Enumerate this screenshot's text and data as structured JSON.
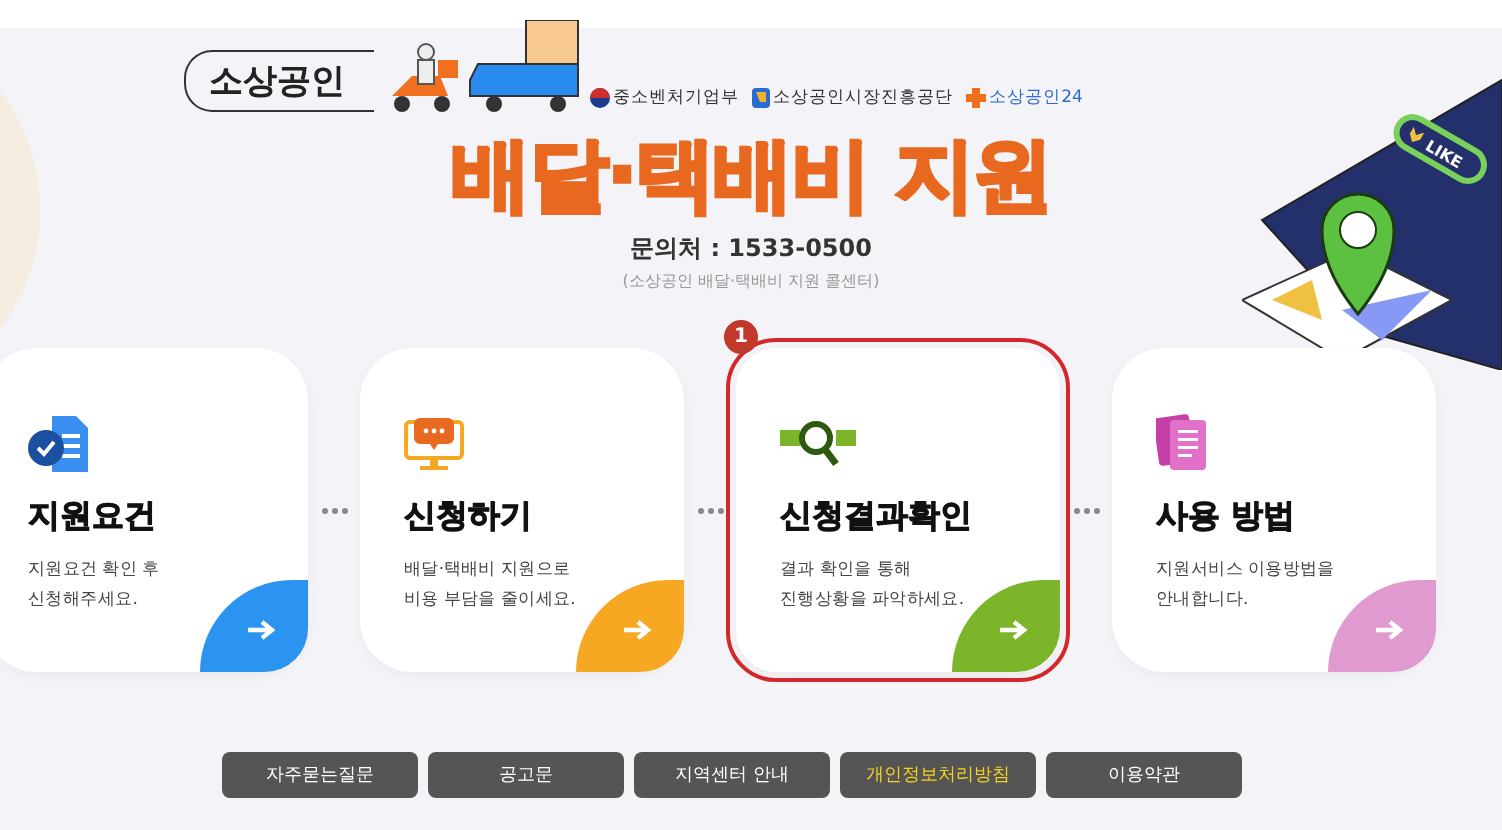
{
  "header": {
    "logo_text": "소상공인",
    "partners": [
      {
        "kind": "ministry",
        "label": "중소벤처기업부"
      },
      {
        "kind": "agency",
        "label": "소상공인시장진흥공단"
      },
      {
        "kind": "portal",
        "label": "소상공인24"
      }
    ],
    "title": "배달·택배비 지원",
    "contact": "문의처 : 1533-0500",
    "contact_note": "(소상공인 배달·택배비 지원 콜센터)"
  },
  "illustration": {
    "label": "LIKE"
  },
  "cards": [
    {
      "kind": "requirements",
      "title": "지원요건",
      "description": [
        "지원요건 확인 후",
        "신청해주세요."
      ],
      "color": "#2b93f0",
      "selected": false
    },
    {
      "kind": "apply",
      "title": "신청하기",
      "description": [
        "배달·택배비 지원으로",
        "비용 부담을 줄이세요."
      ],
      "color": "#f7a823",
      "selected": false
    },
    {
      "kind": "result",
      "title": "신청결과확인",
      "description": [
        "결과 확인을 통해",
        "진행상황을 파악하세요."
      ],
      "color": "#7db52a",
      "selected": true,
      "badge": "1"
    },
    {
      "kind": "guide",
      "title": "사용 방법",
      "description": [
        "지원서비스 이용방법을",
        "안내합니다."
      ],
      "color": "#e09ad0",
      "selected": false
    }
  ],
  "footer_links": [
    {
      "label": "자주묻는질문",
      "highlighted": false
    },
    {
      "label": "공고문",
      "highlighted": false
    },
    {
      "label": "지역센터 안내",
      "highlighted": false
    },
    {
      "label": "개인정보처리방침",
      "highlighted": true
    },
    {
      "label": "이용약관",
      "highlighted": false
    }
  ]
}
